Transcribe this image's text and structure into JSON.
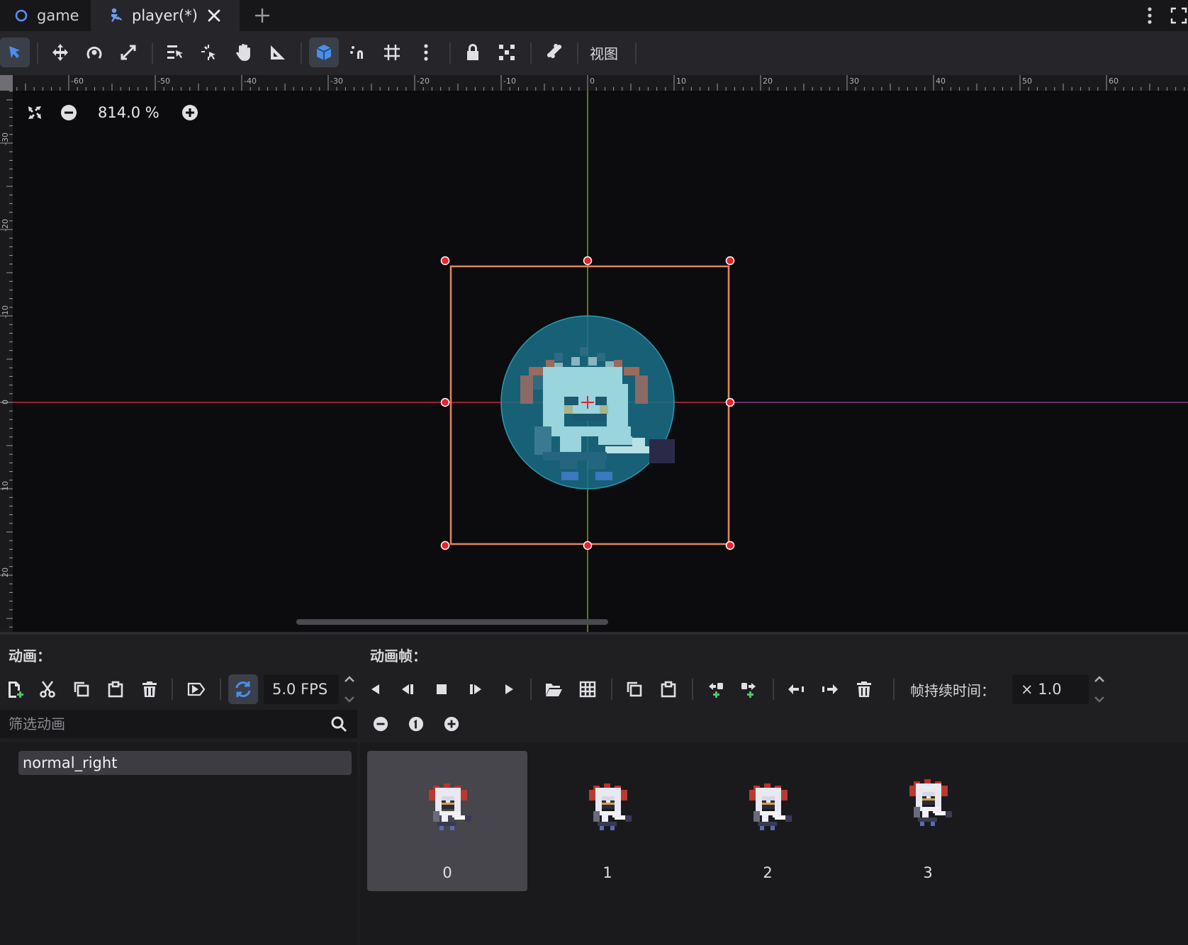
{
  "tabs": [
    {
      "label": "game",
      "icon": "scene-circle-icon"
    },
    {
      "label": "player(*)",
      "icon": "character-node-icon"
    }
  ],
  "toolbar": {
    "view_label": "视图",
    "tools": [
      "select-tool",
      "move-tool",
      "rotate-tool",
      "scale-tool",
      "list-select-tool",
      "pivot-tool",
      "pan-tool",
      "ruler-tool",
      "smart-snap-toggle",
      "snap-toggle",
      "grid-snap-toggle",
      "snap-options-menu",
      "lock-tool",
      "group-tool",
      "skeleton-tool"
    ],
    "active_tools": [
      "select-tool",
      "smart-snap-toggle"
    ]
  },
  "viewport": {
    "zoom_label": "814.0 %",
    "ruler_top_labels": [
      "-60",
      "-50",
      "-40",
      "-30",
      "-20",
      "-10",
      "0",
      "10",
      "20",
      "30",
      "40",
      "50",
      "60"
    ],
    "ruler_left_labels": [
      "-30",
      "-20",
      "-10",
      "0",
      "10",
      "20"
    ]
  },
  "animations_panel": {
    "title": "动画：",
    "fps_value": "5.0 FPS",
    "filter_placeholder": "筛选动画",
    "animations": [
      "normal_right"
    ],
    "selected_animation": "normal_right"
  },
  "frames_panel": {
    "title": "动画帧：",
    "duration_label": "帧持续时间：",
    "duration_value": "× 1.0",
    "frames": [
      "0",
      "1",
      "2",
      "3"
    ],
    "selected_frame": "0"
  },
  "colors": {
    "accent": "#4a8fe8",
    "selection_box": "#e0875a",
    "handle": "#e8232e",
    "axis_x": "#c8283c",
    "axis_y": "#6e9e2a",
    "collision_shape": "#1a7088"
  }
}
